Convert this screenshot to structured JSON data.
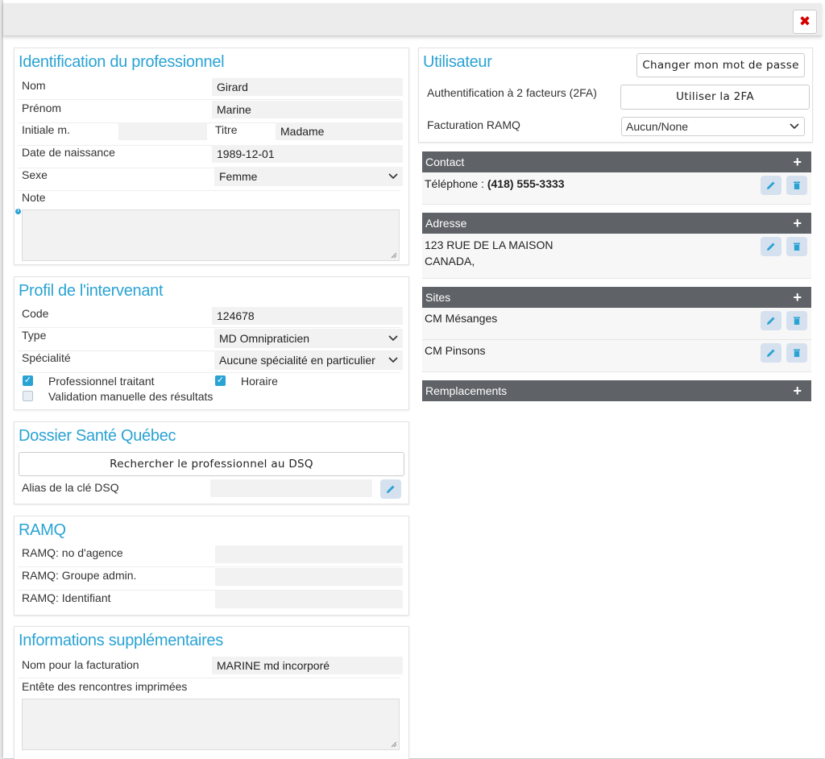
{
  "modal": {
    "close_icon": "✖"
  },
  "identification": {
    "title": "Identification du professionnel",
    "nom_label": "Nom",
    "nom_value": "Girard",
    "prenom_label": "Prénom",
    "prenom_value": "Marine",
    "initiale_label": "Initiale m.",
    "initiale_value": "",
    "titre_label": "Titre",
    "titre_value": "Madame",
    "naissance_label": "Date de naissance",
    "naissance_value": "1989-12-01",
    "sexe_label": "Sexe",
    "sexe_value": "Femme",
    "note_label": "Note",
    "info_icon": "i"
  },
  "profil": {
    "title": "Profil de l'intervenant",
    "code_label": "Code",
    "code_value": "124678",
    "type_label": "Type",
    "type_value": "MD Omnipraticien",
    "specialite_label": "Spécialité",
    "specialite_value": "Aucune spécialité en particulier",
    "traitant_label": "Professionnel traitant",
    "traitant_checked": true,
    "horaire_label": "Horaire",
    "horaire_checked": true,
    "validation_label": "Validation manuelle des résultats",
    "validation_checked": false
  },
  "dsq": {
    "title": "Dossier Santé Québec",
    "search_button": "Rechercher le professionnel au DSQ",
    "alias_label": "Alias de la clé DSQ",
    "alias_value": ""
  },
  "ramq": {
    "title": "RAMQ",
    "agence_label": "RAMQ: no d'agence",
    "agence_value": "",
    "groupe_label": "RAMQ: Groupe admin.",
    "groupe_value": "",
    "identifiant_label": "RAMQ: Identifiant",
    "identifiant_value": ""
  },
  "supp": {
    "title": "Informations supplémentaires",
    "facturation_label": "Nom pour la facturation",
    "facturation_value": "MARINE md incorporé",
    "entete_label": "Entête des rencontres imprimées"
  },
  "utilisateur": {
    "title": "Utilisateur",
    "change_password_button": "Changer mon mot de passe",
    "twofa_label": "Authentification à 2 facteurs (2FA)",
    "twofa_button": "Utiliser la 2FA",
    "facturation_label": "Facturation RAMQ",
    "facturation_value": "Aucun/None"
  },
  "contact": {
    "header": "Contact",
    "phone_label": "Téléphone : ",
    "phone_value": "(418) 555-3333"
  },
  "adresse": {
    "header": "Adresse",
    "line1": "123 RUE DE LA MAISON",
    "line2": "CANADA,"
  },
  "sites": {
    "header": "Sites",
    "items": [
      "CM Mésanges",
      "CM Pinsons"
    ]
  },
  "remplacements": {
    "header": "Remplacements"
  },
  "icons": {
    "plus": "+",
    "chevron": "⌄"
  },
  "colors": {
    "accent": "#2aa3d4",
    "header_bg": "#5f6368",
    "close": "#d40000"
  }
}
